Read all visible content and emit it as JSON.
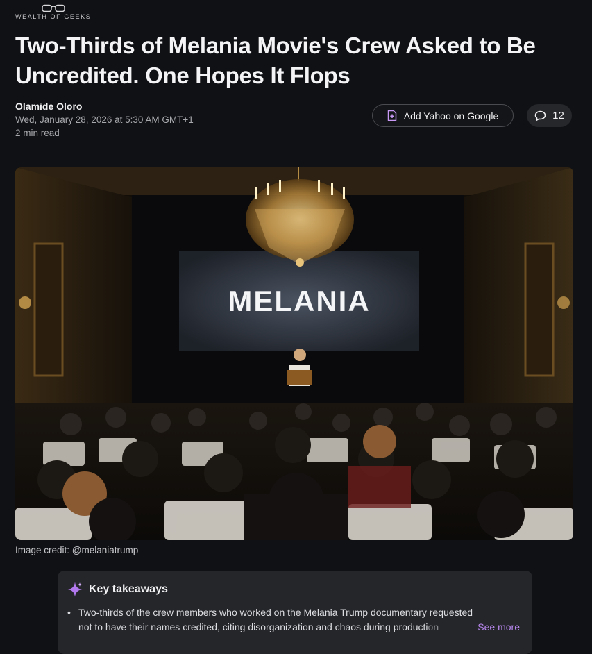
{
  "brand": {
    "name": "WEALTH OF GEEKS",
    "icon": "glasses-logo-icon"
  },
  "article": {
    "title": "Two-Thirds of Melania Movie's Crew Asked to Be Uncredited. One Hopes It Flops",
    "author": "Olamide Oloro",
    "date": "Wed, January 28, 2026 at 5:30 AM GMT+1",
    "read_time": "2 min read"
  },
  "actions": {
    "add_google_label": "Add Yahoo on Google",
    "add_google_icon": "document-plus-icon",
    "comment_count": "12",
    "comment_icon": "speech-bubble-icon"
  },
  "hero": {
    "screen_text": "MELANIA",
    "caption": "Image credit: @melaniatrump"
  },
  "takeaways": {
    "title": "Key takeaways",
    "icon": "sparkle-icon",
    "items": [
      {
        "line1": "Two-thirds of the crew members who worked on the Melania Trump documentary requested",
        "line2": "not to have their names credited, citing disorganization and chaos during producti",
        "line2_fade": "on"
      }
    ],
    "see_more": "See more"
  },
  "colors": {
    "background": "#101114",
    "accent": "#b988f0",
    "card": "#25262a"
  }
}
